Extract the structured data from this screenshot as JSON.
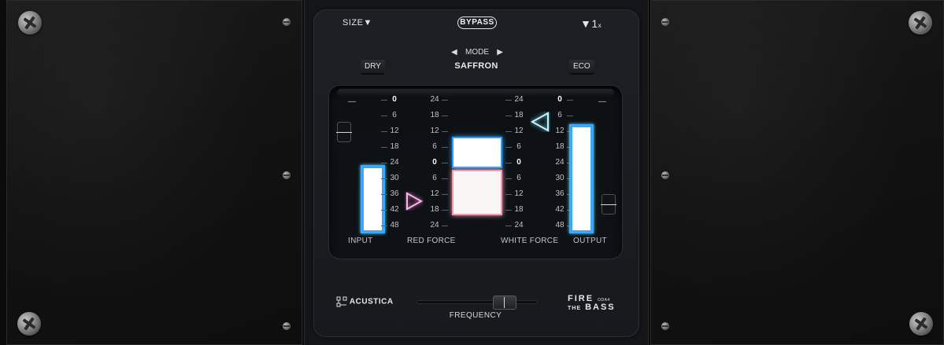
{
  "header": {
    "size_label": "SIZE▼",
    "bypass_label": "BYPASS",
    "oversample_label": "▼1",
    "oversample_suffix": "x"
  },
  "mode": {
    "prev_symbol": "◀",
    "label": "MODE",
    "next_symbol": "▶",
    "current": "SAFFRON"
  },
  "buttons": {
    "dry": "DRY",
    "eco": "ECO"
  },
  "meters": {
    "input": {
      "label": "INPUT",
      "level": 0.62,
      "scale": [
        "—",
        "—"
      ]
    },
    "red_force": {
      "label": "RED FORCE",
      "left_scale": [
        "0",
        "6",
        "12",
        "18",
        "24",
        "30",
        "36",
        "42",
        "48"
      ],
      "right_scale": [
        "24",
        "18",
        "12",
        "6",
        "0",
        "6",
        "12",
        "18",
        "24"
      ]
    },
    "white_force": {
      "label": "WHITE FORCE",
      "left_scale": [
        "24",
        "18",
        "12",
        "6",
        "0",
        "6",
        "12",
        "18",
        "24"
      ],
      "right_scale": [
        "0",
        "6",
        "12",
        "18",
        "24",
        "30",
        "36",
        "42",
        "48"
      ]
    },
    "output": {
      "label": "OUTPUT",
      "level": 0.99
    }
  },
  "footer": {
    "brand": "ACUSTICA",
    "frequency_label": "FREQUENCY",
    "product_line1": "FIRE",
    "product_line1_suffix": "ODA4",
    "product_line2_prefix": "THE",
    "product_line2": "BASS"
  },
  "colors": {
    "meter_glow": "#3aa8ff",
    "red_glow": "#ff7ad0",
    "cyan_glow": "#6fe6ff"
  }
}
